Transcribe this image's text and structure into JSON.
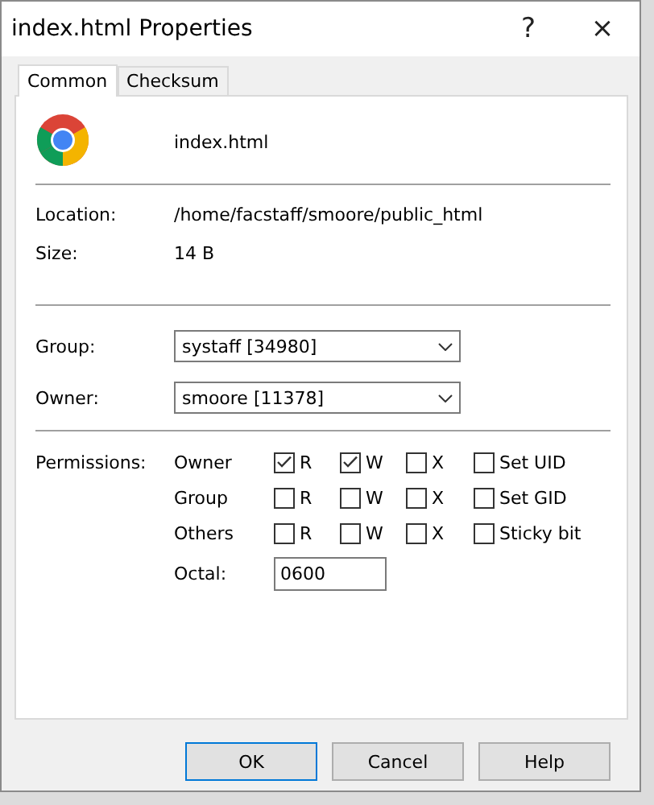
{
  "window": {
    "title": "index.html Properties",
    "help_glyph": "?",
    "close_glyph": "×"
  },
  "tabs": [
    {
      "label": "Common",
      "selected": true
    },
    {
      "label": "Checksum",
      "selected": false
    }
  ],
  "file": {
    "name": "index.html"
  },
  "info": [
    {
      "label": "Location:",
      "value": "/home/facstaff/smoore/public_html"
    },
    {
      "label": "Size:",
      "value": "14 B"
    }
  ],
  "selects": [
    {
      "label": "Group:",
      "value": "systaff [34980]"
    },
    {
      "label": "Owner:",
      "value": "smoore [11378]"
    }
  ],
  "permissions": {
    "label": "Permissions:",
    "rows": [
      {
        "label": "Owner",
        "bits": [
          {
            "label": "R",
            "checked": true
          },
          {
            "label": "W",
            "checked": true
          },
          {
            "label": "X",
            "checked": false
          },
          {
            "label": "Set UID",
            "checked": false
          }
        ]
      },
      {
        "label": "Group",
        "bits": [
          {
            "label": "R",
            "checked": false
          },
          {
            "label": "W",
            "checked": false
          },
          {
            "label": "X",
            "checked": false
          },
          {
            "label": "Set GID",
            "checked": false
          }
        ]
      },
      {
        "label": "Others",
        "bits": [
          {
            "label": "R",
            "checked": false
          },
          {
            "label": "W",
            "checked": false
          },
          {
            "label": "X",
            "checked": false
          },
          {
            "label": "Sticky bit",
            "checked": false
          }
        ]
      }
    ],
    "octal_label": "Octal:",
    "octal_value": "0600"
  },
  "buttons": [
    {
      "label": "OK",
      "default": true
    },
    {
      "label": "Cancel",
      "default": false
    },
    {
      "label": "Help",
      "default": false
    }
  ]
}
